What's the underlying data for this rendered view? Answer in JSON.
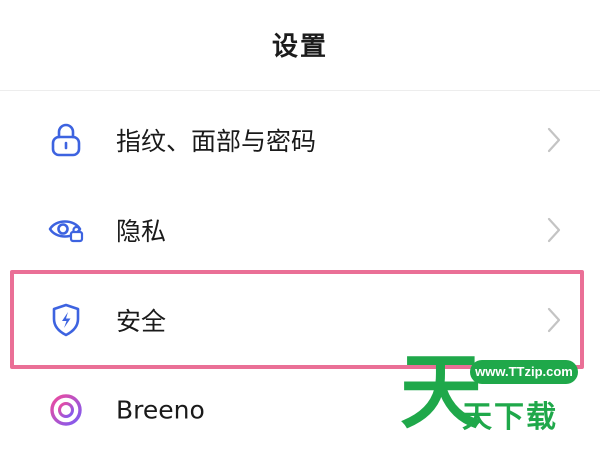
{
  "header": {
    "title": "设置"
  },
  "menu": [
    {
      "label": "指纹、面部与密码",
      "icon": "lock-icon"
    },
    {
      "label": "隐私",
      "icon": "privacy-eye-icon"
    },
    {
      "label": "安全",
      "icon": "shield-icon"
    },
    {
      "label": "Breeno",
      "icon": "breeno-icon"
    }
  ],
  "watermark": {
    "big_char": "天",
    "url": "www.TTzip.com",
    "text": "天下载"
  },
  "colors": {
    "icon_blue": "#3d63e0",
    "highlight_pink": "#ea6f96",
    "watermark_green": "#1fa84a",
    "breeno_gradient": [
      "#f04a9c",
      "#7a5bf5"
    ]
  }
}
